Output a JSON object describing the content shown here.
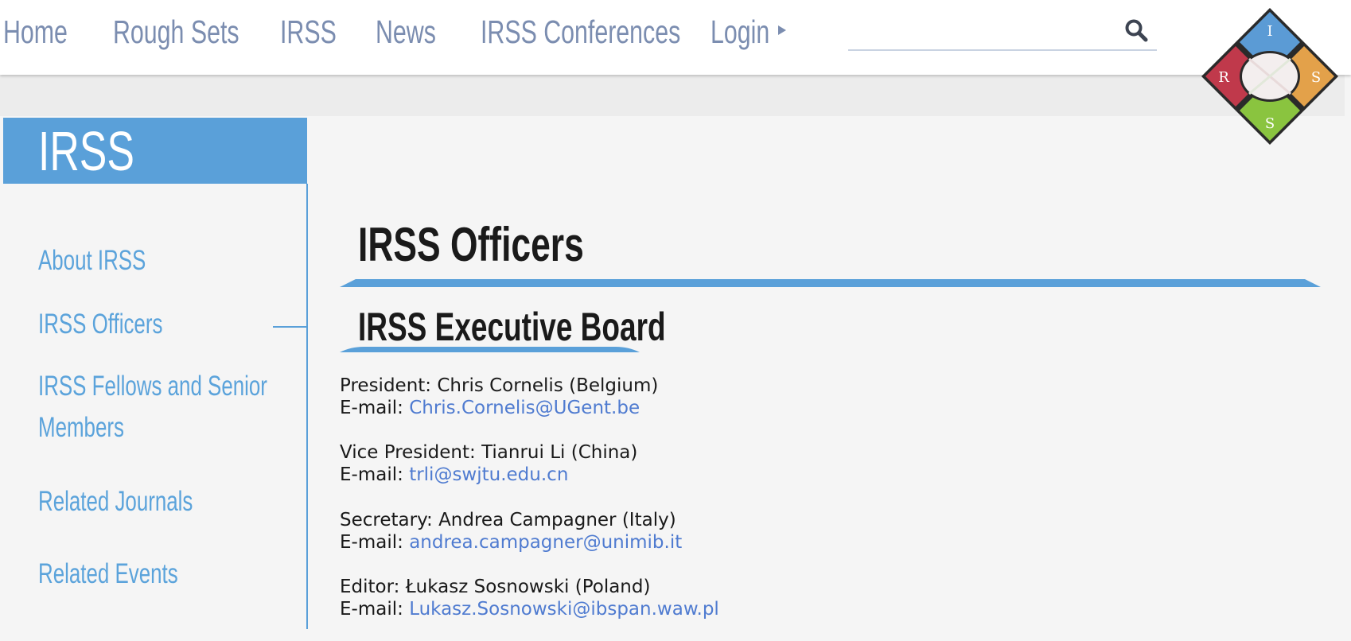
{
  "nav": {
    "items": [
      "Home",
      "Rough Sets",
      "IRSS",
      "News",
      "IRSS Conferences",
      "Login"
    ],
    "search_value": ""
  },
  "logo": {
    "top": "I",
    "left": "R",
    "right": "S",
    "bottom": "S"
  },
  "sidebar": {
    "title": "IRSS",
    "items": [
      {
        "label": "About IRSS"
      },
      {
        "label": "IRSS Officers",
        "active": true
      },
      {
        "label_line1": "IRSS Fellows and Senior",
        "label_line2": "Members"
      },
      {
        "label": "Related Journals"
      },
      {
        "label": "Related Events"
      }
    ]
  },
  "main": {
    "title": "IRSS Officers",
    "section_title": "IRSS Executive Board",
    "email_label": "E-mail:",
    "officers": [
      {
        "role_line": "President: Chris Cornelis (Belgium)",
        "email": "Chris.Cornelis@UGent.be"
      },
      {
        "role_line": "Vice President: Tianrui Li (China)",
        "email": "trli@swjtu.edu.cn"
      },
      {
        "role_line": "Secretary: Andrea Campagner (Italy)",
        "email": "andrea.campagner@unimib.it"
      },
      {
        "role_line": "Editor: Łukasz Sosnowski (Poland)",
        "email": "Lukasz.Sosnowski@ibspan.waw.pl"
      }
    ]
  },
  "colors": {
    "accent": "#5aa0d9",
    "nav_text": "#7b8db0",
    "link": "#4f7bd0",
    "logo_blue": "#5b9bd5",
    "logo_red": "#c0394b",
    "logo_orange": "#e3a14a",
    "logo_green": "#8ac43f"
  }
}
